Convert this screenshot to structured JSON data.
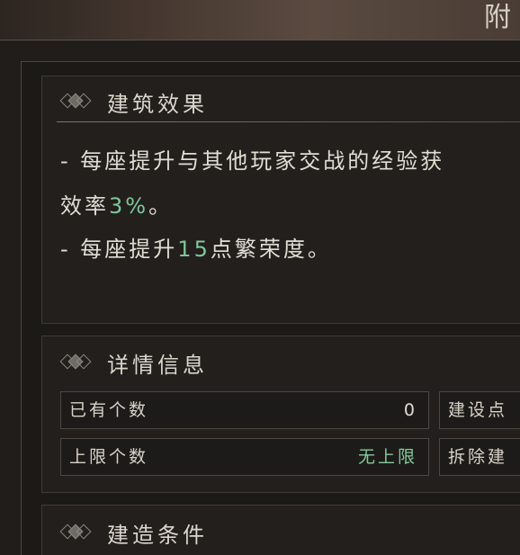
{
  "header": {
    "title": "附"
  },
  "effects": {
    "title": "建筑效果",
    "line1_prefix": "- 每座提升与其他玩家交战的经验获",
    "line2_prefix": "效率",
    "line2_value": "3%",
    "line2_suffix": "。",
    "line3_prefix": "- 每座提升",
    "line3_value": "15",
    "line3_suffix": "点繁荣度。",
    "accent_color": "#7fc79a"
  },
  "details": {
    "title": "详情信息",
    "rows": [
      {
        "label": "已有个数",
        "value": "0"
      },
      {
        "label": "上限个数",
        "value": "无上限"
      }
    ],
    "side_buttons": [
      {
        "label": "建设点"
      },
      {
        "label": "拆除建"
      }
    ]
  },
  "conditions": {
    "title": "建造条件"
  },
  "icons": {
    "section_marker": "diamond-ornament-icon"
  }
}
